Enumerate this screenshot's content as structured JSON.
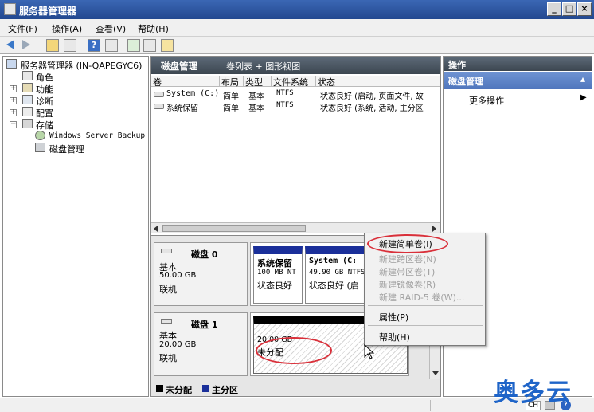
{
  "window": {
    "title": "服务器管理器",
    "min_label": "_",
    "max_label": "□",
    "close_label": "×"
  },
  "menubar": {
    "items": [
      "文件(F)",
      "操作(A)",
      "查看(V)",
      "帮助(H)"
    ]
  },
  "tree": {
    "root": "服务器管理器 (IN-QAPEGYC6)",
    "items": [
      "角色",
      "功能",
      "诊断",
      "配置",
      "存储"
    ],
    "storage_children": [
      "Windows Server Backup",
      "磁盘管理"
    ]
  },
  "center": {
    "header_title": "磁盘管理",
    "header_views": "卷列表 + 图形视图",
    "columns": [
      "卷",
      "布局",
      "类型",
      "文件系统",
      "状态"
    ],
    "rows": [
      {
        "vol": "System (C:)",
        "layout": "简单",
        "type": "基本",
        "fs": "NTFS",
        "status": "状态良好 (启动, 页面文件, 故"
      },
      {
        "vol": "系统保留",
        "layout": "简单",
        "type": "基本",
        "fs": "NTFS",
        "status": "状态良好 (系统, 活动, 主分区"
      }
    ],
    "disks": [
      {
        "name": "磁盘 0",
        "kind": "基本",
        "size": "50.00 GB",
        "state": "联机",
        "partitions": [
          {
            "name": "系统保留",
            "size": "100 MB NT",
            "status": "状态良好"
          },
          {
            "name": "System  (C:",
            "size": "49.90 GB NTFS",
            "status": "状态良好 (启"
          }
        ]
      },
      {
        "name": "磁盘 1",
        "kind": "基本",
        "size": "20.00 GB",
        "state": "联机",
        "partitions": [
          {
            "size": "20.00 GB",
            "status": "未分配"
          }
        ]
      }
    ],
    "legend": [
      "未分配",
      "主分区"
    ],
    "legend_colors": {
      "unallocated": "#000000",
      "primary": "#1a2f9a"
    }
  },
  "right": {
    "header": "操作",
    "section": "磁盘管理",
    "more": "更多操作"
  },
  "context_menu": {
    "items": [
      {
        "label": "新建简单卷(I)",
        "enabled": true
      },
      {
        "label": "新建跨区卷(N)",
        "enabled": false
      },
      {
        "label": "新建带区卷(T)",
        "enabled": false
      },
      {
        "label": "新建镜像卷(R)",
        "enabled": false
      },
      {
        "label": "新建 RAID-5 卷(W)...",
        "enabled": false
      },
      {
        "label": "属性(P)",
        "enabled": true
      },
      {
        "label": "帮助(H)",
        "enabled": true
      }
    ]
  },
  "status": {
    "lang": "CH"
  },
  "watermark": "奥多云",
  "colors": {
    "title_bar": "#2b56a4",
    "section_header": "#4f76bd",
    "annotation": "#d9303a"
  }
}
